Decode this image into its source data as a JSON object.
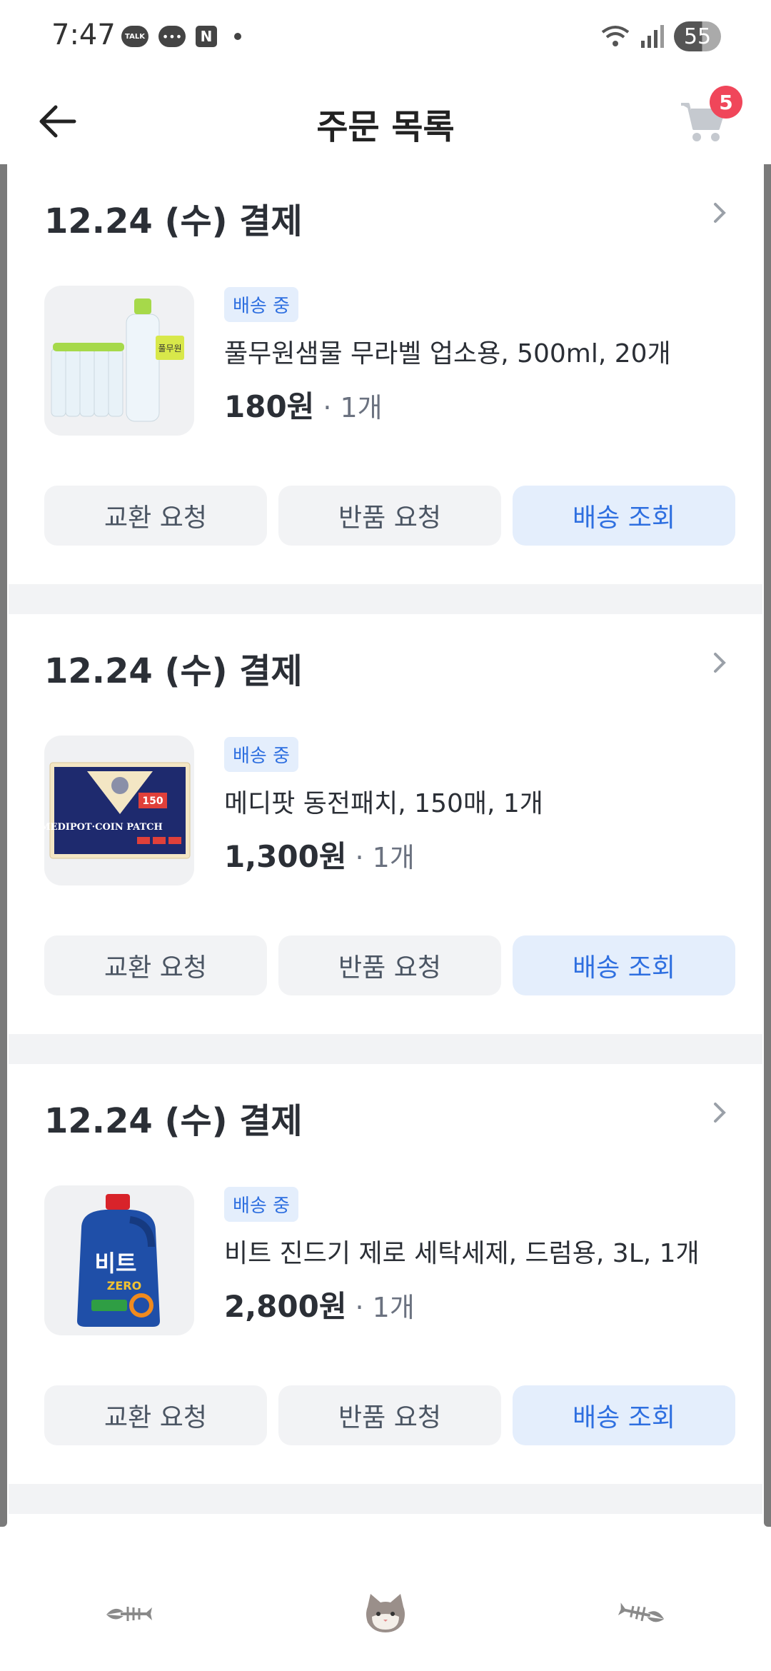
{
  "status_bar": {
    "time": "7:47",
    "talk_label": "TALK",
    "n_label": "N",
    "battery": "55"
  },
  "header": {
    "title": "주문 목록",
    "cart_count": "5"
  },
  "orders": [
    {
      "date": "12.24 (수) 결제",
      "status": "배송 중",
      "product": "풀무원샘물 무라벨 업소용, 500ml, 20개",
      "price": "180원",
      "qty": "· 1개",
      "buttons": [
        "교환 요청",
        "반품 요청",
        "배송 조회"
      ]
    },
    {
      "date": "12.24 (수) 결제",
      "status": "배송 중",
      "product": "메디팟 동전패치, 150매, 1개",
      "price": "1,300원",
      "qty": "· 1개",
      "buttons": [
        "교환 요청",
        "반품 요청",
        "배송 조회"
      ]
    },
    {
      "date": "12.24 (수) 결제",
      "status": "배송 중",
      "product": "비트 진드기 제로 세탁세제, 드럼용, 3L, 1개",
      "price": "2,800원",
      "qty": "· 1개",
      "buttons": [
        "교환 요청",
        "반품 요청",
        "배송 조회"
      ]
    }
  ],
  "product_images": {
    "water_label": "풀무원",
    "patch_label": "MEDIPOT·COIN PATCH",
    "patch_count": "150",
    "detergent_label": "비트",
    "detergent_sub": "ZERO"
  },
  "colors": {
    "accent": "#2e6fe0",
    "accent_bg": "#e4eefc",
    "badge_red": "#f0465a",
    "separator": "#f2f3f5"
  },
  "bottom_nav": {
    "items": [
      "fish-bone-icon",
      "cat-face-icon",
      "fish-bone-icon"
    ]
  }
}
